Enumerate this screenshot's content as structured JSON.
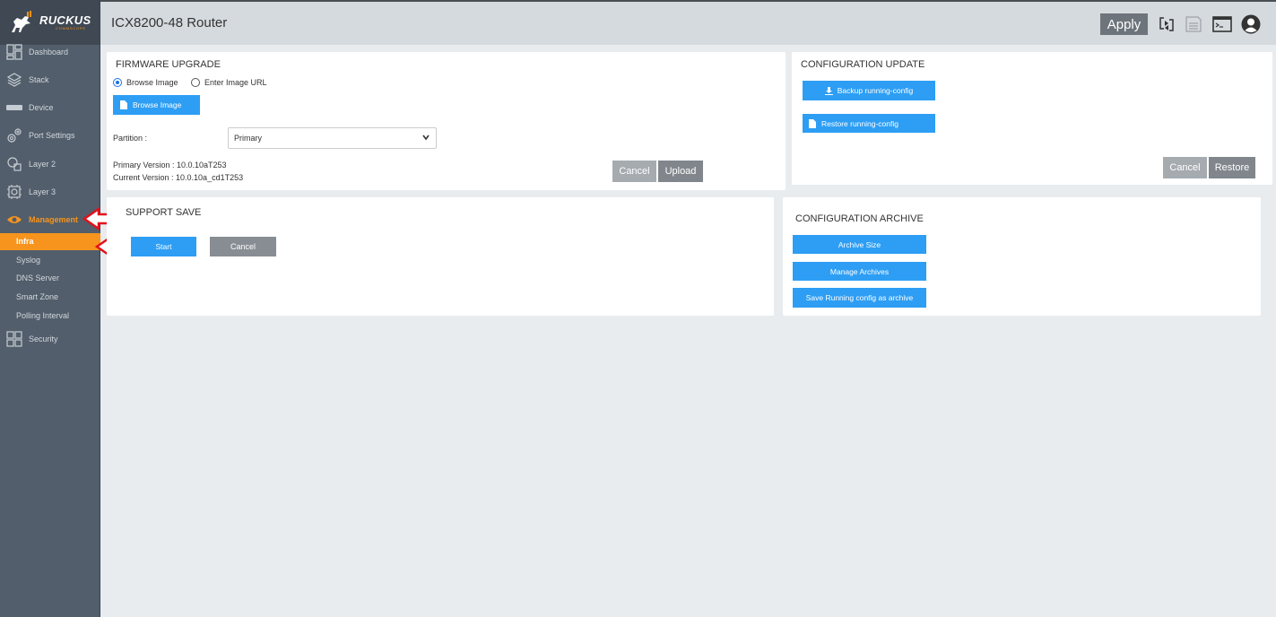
{
  "brand": {
    "name": "RUCKUS",
    "sub": "COMMSCOPE",
    "accent": "#f7941d"
  },
  "header": {
    "title": "ICX8200-48 Router",
    "apply_label": "Apply"
  },
  "sidebar": {
    "items": [
      {
        "label": "Dashboard",
        "icon": "dashboard-icon"
      },
      {
        "label": "Stack",
        "icon": "stack-icon"
      },
      {
        "label": "Device",
        "icon": "device-icon"
      },
      {
        "label": "Port Settings",
        "icon": "port-settings-icon"
      },
      {
        "label": "Layer 2",
        "icon": "layer2-icon"
      },
      {
        "label": "Layer 3",
        "icon": "layer3-icon"
      },
      {
        "label": "Management",
        "icon": "eye-icon"
      },
      {
        "label": "Security",
        "icon": "security-icon"
      }
    ],
    "subitems": [
      {
        "label": "Infra"
      },
      {
        "label": "Syslog"
      },
      {
        "label": "DNS Server"
      },
      {
        "label": "Smart Zone"
      },
      {
        "label": "Polling Interval"
      }
    ]
  },
  "firmware": {
    "title": "FIRMWARE UPGRADE",
    "radio_browse": "Browse Image",
    "radio_url": "Enter Image URL",
    "browse_button": "Browse Image",
    "partition_label": "Partition :",
    "partition_value": "Primary",
    "primary_version": "Primary Version : 10.0.10aT253",
    "current_version": "Current Version : 10.0.10a_cd1T253",
    "cancel": "Cancel",
    "upload": "Upload"
  },
  "config_update": {
    "title": "CONFIGURATION UPDATE",
    "backup": "Backup running-config",
    "restore_btn": "Restore running-config",
    "cancel": "Cancel",
    "restore": "Restore"
  },
  "support_save": {
    "title": "SUPPORT SAVE",
    "start": "Start",
    "cancel": "Cancel"
  },
  "config_archive": {
    "title": "CONFIGURATION ARCHIVE",
    "archive_size": "Archive Size",
    "manage": "Manage Archives",
    "save_running": "Save Running config as archive"
  }
}
